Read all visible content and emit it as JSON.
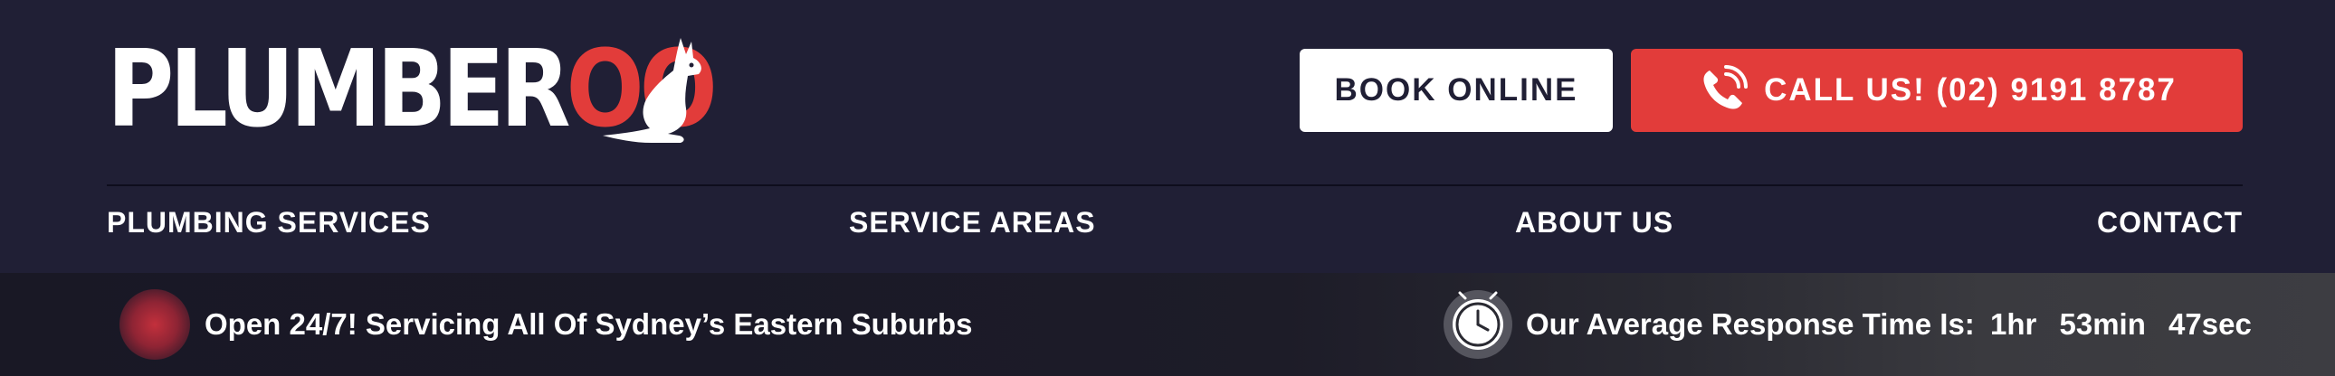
{
  "logo": {
    "part1": "PLUMBER",
    "part2": "OO"
  },
  "header": {
    "book_label": "BOOK ONLINE",
    "call_label": "CALL US! (02) 9191 8787"
  },
  "nav": {
    "items": [
      {
        "label": "PLUMBING SERVICES"
      },
      {
        "label": "SERVICE AREAS"
      },
      {
        "label": "ABOUT US"
      },
      {
        "label": "CONTACT"
      }
    ]
  },
  "infobar": {
    "left_text": "Open 24/7! Servicing All Of Sydney’s Eastern Suburbs",
    "right_label": "Our Average Response Time Is:",
    "hours": "1hr",
    "minutes": "53min",
    "seconds": "47sec"
  },
  "colors": {
    "background": "#201f35",
    "accent_red": "#e23c3a",
    "white": "#ffffff"
  },
  "icons": [
    "kangaroo-icon",
    "phone-icon",
    "pulse-icon",
    "clock-icon"
  ]
}
